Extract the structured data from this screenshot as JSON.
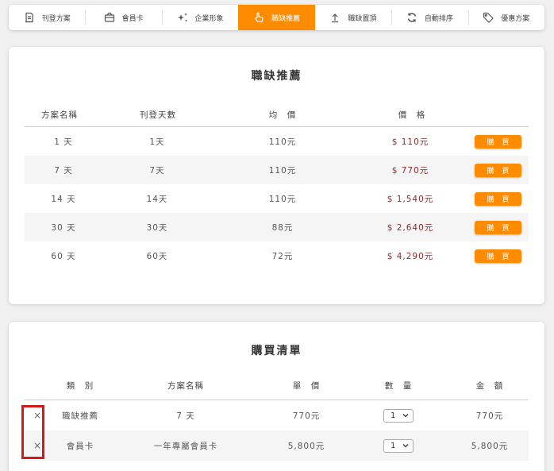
{
  "nav": {
    "items": [
      {
        "label": "刊登方案",
        "icon": "document-icon",
        "active": false
      },
      {
        "label": "會員卡",
        "icon": "card-icon",
        "active": false
      },
      {
        "label": "企業形象",
        "icon": "sparkle-icon",
        "active": false
      },
      {
        "label": "職缺推薦",
        "icon": "hand-pointer-icon",
        "active": true
      },
      {
        "label": "職缺置頂",
        "icon": "upload-arrow-icon",
        "active": false
      },
      {
        "label": "自動排序",
        "icon": "sync-icon",
        "active": false
      },
      {
        "label": "優惠方案",
        "icon": "tag-icon",
        "active": false
      }
    ]
  },
  "recommend": {
    "title": "職缺推薦",
    "columns": [
      "方案名稱",
      "刊登天數",
      "均　價",
      "價　格"
    ],
    "buy_label": "購買",
    "rows": [
      {
        "name": "1 天",
        "days": "1天",
        "avg": "110元",
        "price": "$ 110元"
      },
      {
        "name": "7 天",
        "days": "7天",
        "avg": "110元",
        "price": "$ 770元"
      },
      {
        "name": "14 天",
        "days": "14天",
        "avg": "110元",
        "price": "$ 1,540元"
      },
      {
        "name": "30 天",
        "days": "30天",
        "avg": "88元",
        "price": "$ 2,640元"
      },
      {
        "name": "60 天",
        "days": "60天",
        "avg": "72元",
        "price": "$ 4,290元"
      }
    ]
  },
  "cart": {
    "title": "購買清單",
    "columns": [
      "類　別",
      "方案名稱",
      "單　價",
      "數　量",
      "金　額"
    ],
    "rows": [
      {
        "remove": "×",
        "category": "職缺推薦",
        "plan": "7 天",
        "unit": "770元",
        "qty": "1",
        "amount": "770元"
      },
      {
        "remove": "×",
        "category": "會員卡",
        "plan": "一年專屬會員卡",
        "unit": "5,800元",
        "qty": "1",
        "amount": "5,800元"
      }
    ]
  },
  "colors": {
    "accent": "#ff8c00",
    "price": "#8b2a2a",
    "highlight": "#d01b1b"
  }
}
